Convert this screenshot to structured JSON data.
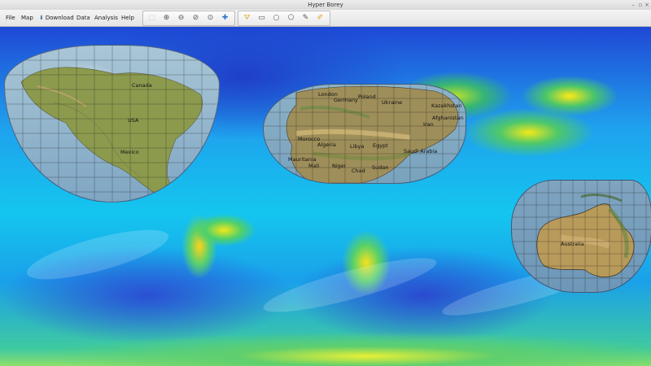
{
  "window": {
    "title": "Hyper Borey",
    "minimize_glyph": "–",
    "restore_glyph": "▫",
    "close_glyph": "×"
  },
  "menu": {
    "file": "File",
    "map": "Map",
    "download": "Download",
    "data": "Data",
    "analysis": "Analysis",
    "help": "Help"
  },
  "toolbar": {
    "nav_group": [
      {
        "name": "select-tool",
        "icon": "pointer-icon",
        "glyph": "⬚",
        "state": "disabled"
      },
      {
        "name": "zoom-in",
        "icon": "zoom-in-icon",
        "glyph": "⊕"
      },
      {
        "name": "zoom-out",
        "icon": "zoom-out-icon",
        "glyph": "⊖"
      },
      {
        "name": "zoom-previous",
        "icon": "zoom-previous-icon",
        "glyph": "⊘"
      },
      {
        "name": "zoom-next",
        "icon": "zoom-next-icon",
        "glyph": "⊙"
      },
      {
        "name": "pan",
        "icon": "move-cross-icon",
        "glyph": "✚"
      }
    ],
    "draw_group": [
      {
        "name": "point-tool",
        "icon": "point-marker-icon",
        "glyph": "⛛"
      },
      {
        "name": "rectangle-tool",
        "icon": "rectangle-select-icon",
        "glyph": "▭"
      },
      {
        "name": "circle-tool",
        "icon": "circle-select-icon",
        "glyph": "○"
      },
      {
        "name": "polygon-tool",
        "icon": "polygon-select-icon",
        "glyph": "⬠"
      },
      {
        "name": "edit-tool",
        "icon": "edit-pencil-icon",
        "glyph": "✎"
      },
      {
        "name": "measure-tool",
        "icon": "ruler-pencil-icon",
        "glyph": "✐"
      }
    ]
  },
  "map": {
    "regions": {
      "north_america": {
        "labels": {
          "canada": "Canada",
          "usa": "USA",
          "mexico": "Mexico"
        }
      },
      "africa_eurasia": {
        "labels": {
          "london": "London",
          "germany": "Germany",
          "poland": "Poland",
          "ukraine": "Ukraine",
          "kazakhstan": "Kazakhstan",
          "morocco": "Morocco",
          "algeria": "Algeria",
          "libya": "Libya",
          "egypt": "Egypt",
          "saudi_arabia": "Saudi Arabia",
          "mauritania": "Mauritania",
          "mali": "Mali",
          "niger": "Niger",
          "chad": "Chad",
          "sudan": "Sudan",
          "iran": "Iran",
          "afghanistan": "Afghanistan"
        }
      },
      "australia": {
        "labels": {
          "australia": "Australia"
        }
      }
    }
  }
}
